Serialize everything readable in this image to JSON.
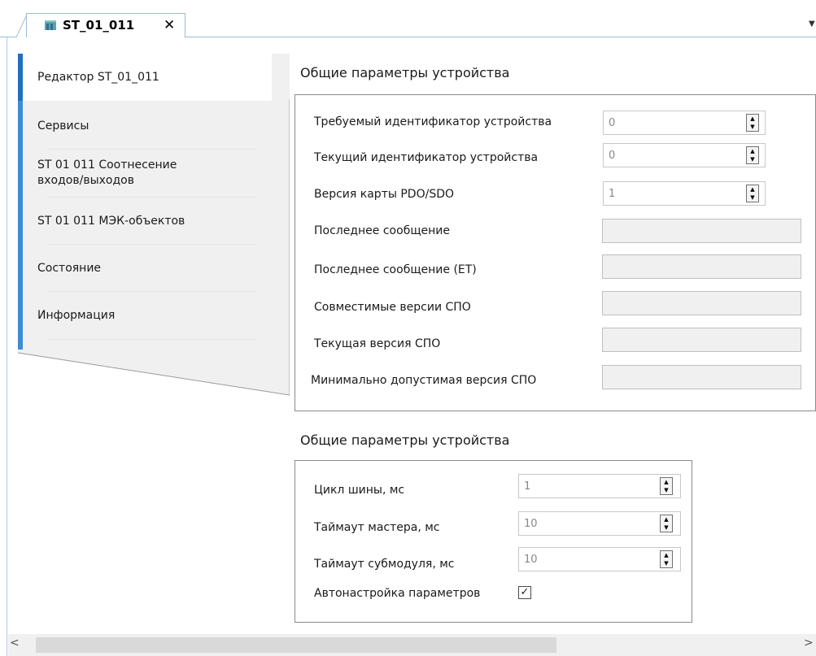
{
  "tab": {
    "title": "ST_01_011",
    "close_glyph": "✕",
    "icon": "device-icon",
    "menu_glyph": "▼"
  },
  "sidebar": {
    "items": [
      {
        "label": "Редактор ST_01_011"
      },
      {
        "label": "Сервисы"
      },
      {
        "label": "ST 01 011 Соотнесение входов/выходов"
      },
      {
        "label": "ST 01 011 МЭК-объектов"
      },
      {
        "label": "Состояние"
      },
      {
        "label": "Информация"
      }
    ]
  },
  "section1": {
    "title": "Общие параметры устройства",
    "spin_fields": [
      {
        "label": "Требуемый идентификатор устройства",
        "value": "0"
      },
      {
        "label": "Текущий идентификатор устройства",
        "value": "0"
      },
      {
        "label": "Версия карты PDO/SDO",
        "value": "1"
      }
    ],
    "readonly_fields": [
      {
        "label": "Последнее сообщение"
      },
      {
        "label": "Последнее сообщение (ET)"
      },
      {
        "label": "Совместимые версии СПО"
      },
      {
        "label": "Текущая версия СПО"
      },
      {
        "label": "Минимально допустимая версия СПО"
      }
    ]
  },
  "section2": {
    "title": "Общие параметры устройства",
    "spin_fields": [
      {
        "label": "Цикл шины, мс",
        "value": "1"
      },
      {
        "label": "Таймаут мастера, мс",
        "value": "10"
      },
      {
        "label": "Таймаут субмодуля, мс",
        "value": "10"
      }
    ],
    "autotune": {
      "label": "Автонастройка параметров",
      "checked_glyph": "✓",
      "checked": true
    }
  },
  "scrollbar": {
    "left_glyph": "<",
    "right_glyph": ">"
  },
  "colors": {
    "accent": "#3e8cd6",
    "tab_border": "#9fb9d6",
    "panel_bg": "#f0f0f0"
  }
}
